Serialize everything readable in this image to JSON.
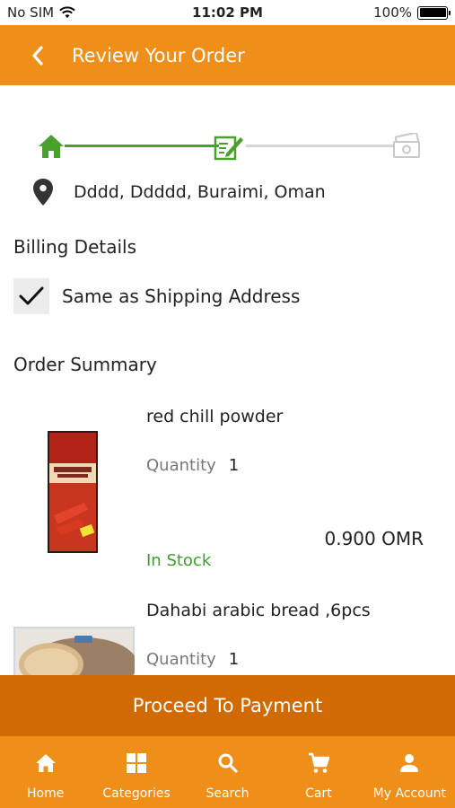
{
  "status_bar": {
    "carrier": "No SIM",
    "time": "11:02 PM",
    "battery": "100%"
  },
  "header": {
    "title": "Review Your Order"
  },
  "progress": {
    "steps": [
      "home-icon",
      "edit-order-icon",
      "money-icon"
    ],
    "current_step": 2,
    "active_color": "#4aa02c",
    "inactive_color": "#d6d6d6"
  },
  "address": {
    "text": "Dddd, Ddddd, Buraimi, Oman"
  },
  "billing": {
    "title": "Billing Details",
    "same_as_shipping_label": "Same as Shipping Address",
    "same_as_shipping_checked": true
  },
  "order_summary": {
    "title": "Order Summary",
    "items": [
      {
        "name": "red chill powder",
        "quantity_label": "Quantity",
        "quantity": "1",
        "price": "0.900 OMR",
        "stock": "In Stock"
      },
      {
        "name": "Dahabi arabic bread ,6pcs",
        "quantity_label": "Quantity",
        "quantity": "1"
      }
    ]
  },
  "proceed_button": {
    "label": "Proceed To Payment"
  },
  "tab_bar": {
    "tabs": [
      {
        "label": "Home",
        "icon": "home-icon"
      },
      {
        "label": "Categories",
        "icon": "grid-icon"
      },
      {
        "label": "Search",
        "icon": "search-icon"
      },
      {
        "label": "Cart",
        "icon": "cart-icon"
      },
      {
        "label": "My Account",
        "icon": "person-icon"
      }
    ]
  },
  "colors": {
    "brand": "#ef8f1a",
    "button": "#d26a03",
    "in_stock": "#3c9e2a"
  }
}
